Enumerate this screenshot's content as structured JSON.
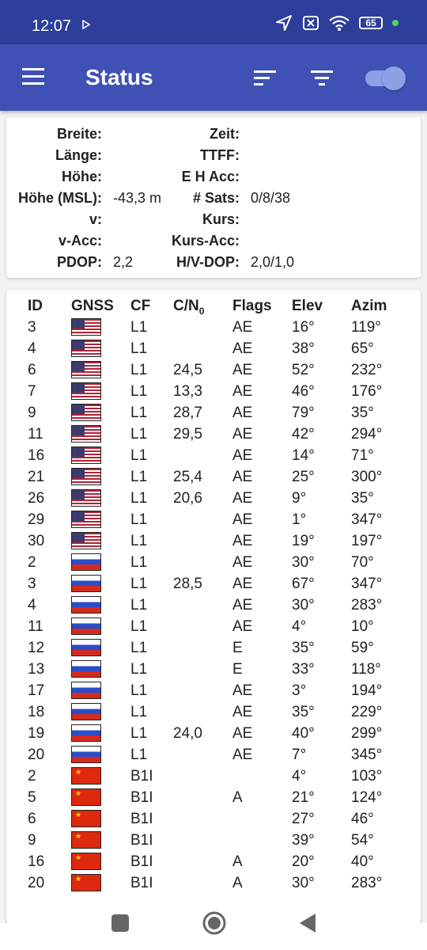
{
  "status_bar": {
    "time": "12:07",
    "battery": "65"
  },
  "app_bar": {
    "title": "Status"
  },
  "info": [
    {
      "label": "Breite:",
      "value": "",
      "label2": "Zeit:",
      "value2": ""
    },
    {
      "label": "Länge:",
      "value": "",
      "label2": "TTFF:",
      "value2": ""
    },
    {
      "label": "Höhe:",
      "value": "",
      "label2": "E H Acc:",
      "value2": ""
    },
    {
      "label": "Höhe (MSL):",
      "value": "-43,3 m",
      "label2": "# Sats:",
      "value2": "0/8/38"
    },
    {
      "label": "v:",
      "value": "",
      "label2": "Kurs:",
      "value2": ""
    },
    {
      "label": "v-Acc:",
      "value": "",
      "label2": "Kurs-Acc:",
      "value2": ""
    },
    {
      "label": "PDOP:",
      "value": "2,2",
      "label2": "H/V-DOP:",
      "value2": "2,0/1,0"
    }
  ],
  "table": {
    "headers": {
      "id": "ID",
      "gnss": "GNSS",
      "cf": "CF",
      "cn0": "C/N",
      "cn0_sub": "0",
      "flags": "Flags",
      "elev": "Elev",
      "azim": "Azim"
    },
    "rows": [
      {
        "id": "3",
        "gnss": "us",
        "cf": "L1",
        "cn0": "",
        "flags": "AE",
        "elev": "16°",
        "azim": "119°"
      },
      {
        "id": "4",
        "gnss": "us",
        "cf": "L1",
        "cn0": "",
        "flags": "AE",
        "elev": "38°",
        "azim": "65°"
      },
      {
        "id": "6",
        "gnss": "us",
        "cf": "L1",
        "cn0": "24,5",
        "flags": "AE",
        "elev": "52°",
        "azim": "232°"
      },
      {
        "id": "7",
        "gnss": "us",
        "cf": "L1",
        "cn0": "13,3",
        "flags": "AE",
        "elev": "46°",
        "azim": "176°"
      },
      {
        "id": "9",
        "gnss": "us",
        "cf": "L1",
        "cn0": "28,7",
        "flags": "AE",
        "elev": "79°",
        "azim": "35°"
      },
      {
        "id": "11",
        "gnss": "us",
        "cf": "L1",
        "cn0": "29,5",
        "flags": "AE",
        "elev": "42°",
        "azim": "294°"
      },
      {
        "id": "16",
        "gnss": "us",
        "cf": "L1",
        "cn0": "",
        "flags": "AE",
        "elev": "14°",
        "azim": "71°"
      },
      {
        "id": "21",
        "gnss": "us",
        "cf": "L1",
        "cn0": "25,4",
        "flags": "AE",
        "elev": "25°",
        "azim": "300°"
      },
      {
        "id": "26",
        "gnss": "us",
        "cf": "L1",
        "cn0": "20,6",
        "flags": "AE",
        "elev": "9°",
        "azim": "35°"
      },
      {
        "id": "29",
        "gnss": "us",
        "cf": "L1",
        "cn0": "",
        "flags": "AE",
        "elev": "1°",
        "azim": "347°"
      },
      {
        "id": "30",
        "gnss": "us",
        "cf": "L1",
        "cn0": "",
        "flags": "AE",
        "elev": "19°",
        "azim": "197°"
      },
      {
        "id": "2",
        "gnss": "ru",
        "cf": "L1",
        "cn0": "",
        "flags": "AE",
        "elev": "30°",
        "azim": "70°"
      },
      {
        "id": "3",
        "gnss": "ru",
        "cf": "L1",
        "cn0": "28,5",
        "flags": "AE",
        "elev": "67°",
        "azim": "347°"
      },
      {
        "id": "4",
        "gnss": "ru",
        "cf": "L1",
        "cn0": "",
        "flags": "AE",
        "elev": "30°",
        "azim": "283°"
      },
      {
        "id": "11",
        "gnss": "ru",
        "cf": "L1",
        "cn0": "",
        "flags": "AE",
        "elev": "4°",
        "azim": "10°"
      },
      {
        "id": "12",
        "gnss": "ru",
        "cf": "L1",
        "cn0": "",
        "flags": "E",
        "elev": "35°",
        "azim": "59°"
      },
      {
        "id": "13",
        "gnss": "ru",
        "cf": "L1",
        "cn0": "",
        "flags": "E",
        "elev": "33°",
        "azim": "118°"
      },
      {
        "id": "17",
        "gnss": "ru",
        "cf": "L1",
        "cn0": "",
        "flags": "AE",
        "elev": "3°",
        "azim": "194°"
      },
      {
        "id": "18",
        "gnss": "ru",
        "cf": "L1",
        "cn0": "",
        "flags": "AE",
        "elev": "35°",
        "azim": "229°"
      },
      {
        "id": "19",
        "gnss": "ru",
        "cf": "L1",
        "cn0": "24,0",
        "flags": "AE",
        "elev": "40°",
        "azim": "299°"
      },
      {
        "id": "20",
        "gnss": "ru",
        "cf": "L1",
        "cn0": "",
        "flags": "AE",
        "elev": "7°",
        "azim": "345°"
      },
      {
        "id": "2",
        "gnss": "cn",
        "cf": "B1I",
        "cn0": "",
        "flags": "",
        "elev": "4°",
        "azim": "103°"
      },
      {
        "id": "5",
        "gnss": "cn",
        "cf": "B1I",
        "cn0": "",
        "flags": "A",
        "elev": "21°",
        "azim": "124°"
      },
      {
        "id": "6",
        "gnss": "cn",
        "cf": "B1I",
        "cn0": "",
        "flags": "",
        "elev": "27°",
        "azim": "46°"
      },
      {
        "id": "9",
        "gnss": "cn",
        "cf": "B1I",
        "cn0": "",
        "flags": "",
        "elev": "39°",
        "azim": "54°"
      },
      {
        "id": "16",
        "gnss": "cn",
        "cf": "B1I",
        "cn0": "",
        "flags": "A",
        "elev": "20°",
        "azim": "40°"
      },
      {
        "id": "20",
        "gnss": "cn",
        "cf": "B1I",
        "cn0": "",
        "flags": "A",
        "elev": "30°",
        "azim": "283°"
      }
    ]
  },
  "colors": {
    "status_bar": "#2c3e9a",
    "app_bar": "#3f51b5",
    "toggle": "#8fa0e6"
  },
  "icons": [
    "menu-icon",
    "sort-icon",
    "filter-icon",
    "toggle-switch",
    "location-arrow-icon",
    "sim-off-icon",
    "wifi-icon",
    "battery-icon",
    "recents-icon",
    "home-icon",
    "back-icon"
  ]
}
